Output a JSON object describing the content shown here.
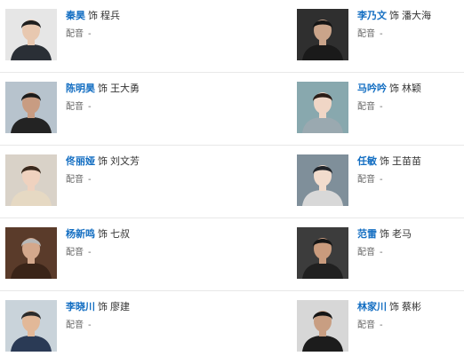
{
  "labels": {
    "as": "饰",
    "dub": "配音"
  },
  "cast": [
    {
      "actor": "秦昊",
      "role": "程兵",
      "dub": "-",
      "photo": {
        "bg": "#e6e6e6",
        "skin": "#e8c8b0",
        "hair": "#1e1e1e",
        "cloth": "#2a2f36"
      }
    },
    {
      "actor": "李乃文",
      "role": "潘大海",
      "dub": "-",
      "photo": {
        "bg": "#2f2f2f",
        "skin": "#caa48a",
        "hair": "#141414",
        "cloth": "#1a1a1a"
      }
    },
    {
      "actor": "陈明昊",
      "role": "王大勇",
      "dub": "-",
      "photo": {
        "bg": "#b7c3cd",
        "skin": "#c89c82",
        "hair": "#1b1b1b",
        "cloth": "#232323"
      }
    },
    {
      "actor": "马吟吟",
      "role": "林颖",
      "dub": "-",
      "photo": {
        "bg": "#88a8ae",
        "skin": "#f0d6c6",
        "hair": "#2a1c16",
        "cloth": "#9aa9b0"
      }
    },
    {
      "actor": "佟丽娅",
      "role": "刘文芳",
      "dub": "-",
      "photo": {
        "bg": "#d9d2c8",
        "skin": "#efd2bf",
        "hair": "#3a2a1e",
        "cloth": "#e6d9c3"
      }
    },
    {
      "actor": "任敏",
      "role": "王苗苗",
      "dub": "-",
      "photo": {
        "bg": "#7f8f9a",
        "skin": "#f2dccd",
        "hair": "#20242a",
        "cloth": "#d8d8d8"
      }
    },
    {
      "actor": "杨新鸣",
      "role": "七叔",
      "dub": "-",
      "photo": {
        "bg": "#5a3b2a",
        "skin": "#d4a88c",
        "hair": "#b8b8b8",
        "cloth": "#3a2418"
      }
    },
    {
      "actor": "范雷",
      "role": "老马",
      "dub": "-",
      "photo": {
        "bg": "#3c3c3c",
        "skin": "#c99b7d",
        "hair": "#161616",
        "cloth": "#202020"
      }
    },
    {
      "actor": "李晓川",
      "role": "廖建",
      "dub": "-",
      "photo": {
        "bg": "#c9d3da",
        "skin": "#e2b898",
        "hair": "#2b2b2b",
        "cloth": "#2a3a55"
      }
    },
    {
      "actor": "林家川",
      "role": "蔡彬",
      "dub": "-",
      "photo": {
        "bg": "#d7d7d7",
        "skin": "#c89e82",
        "hair": "#151515",
        "cloth": "#1c1c1c"
      }
    }
  ]
}
